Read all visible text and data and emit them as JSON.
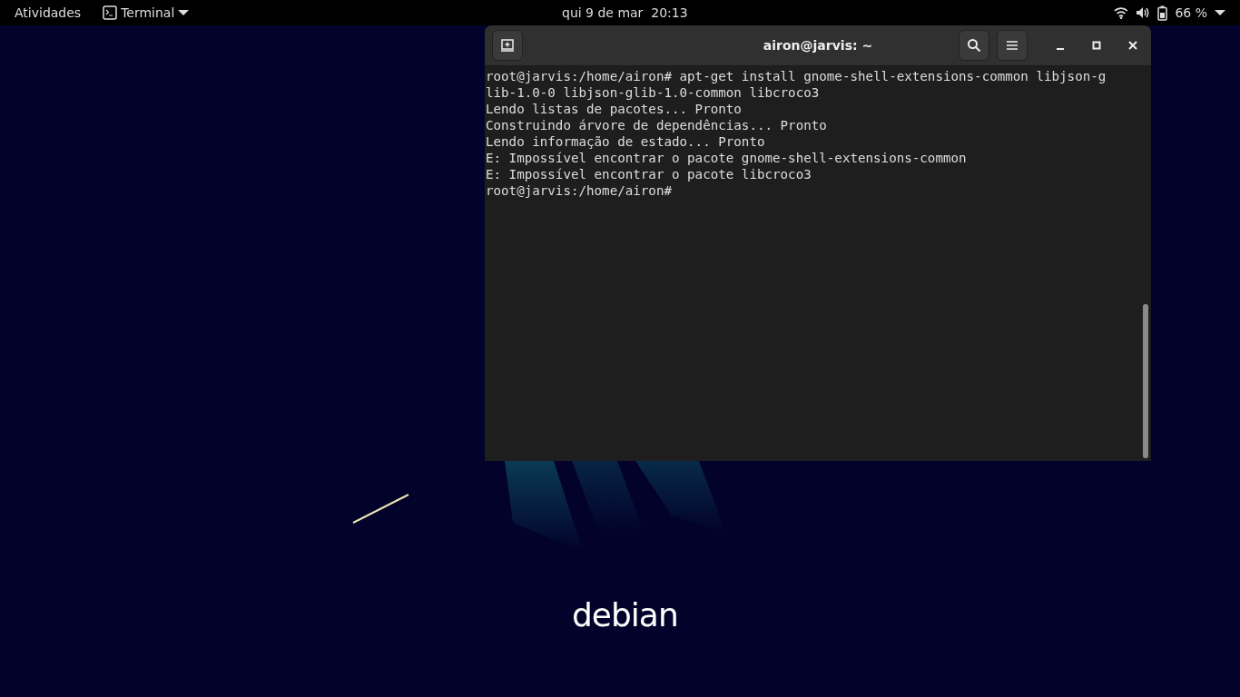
{
  "top_bar": {
    "activities": "Atividades",
    "app_menu": "Terminal",
    "clock": "qui 9 de mar  20:13",
    "battery": "66 %"
  },
  "window": {
    "title": "airon@jarvis: ~",
    "lines": [
      "root@jarvis:/home/airon# apt-get install gnome-shell-extensions-common libjson-g",
      "lib-1.0-0 libjson-glib-1.0-common libcroco3",
      "Lendo listas de pacotes... Pronto",
      "Construindo árvore de dependências... Pronto",
      "Lendo informação de estado... Pronto",
      "E: Impossível encontrar o pacote gnome-shell-extensions-common",
      "E: Impossível encontrar o pacote libcroco3",
      "root@jarvis:/home/airon#"
    ]
  },
  "wallpaper": {
    "logo": "debian"
  }
}
